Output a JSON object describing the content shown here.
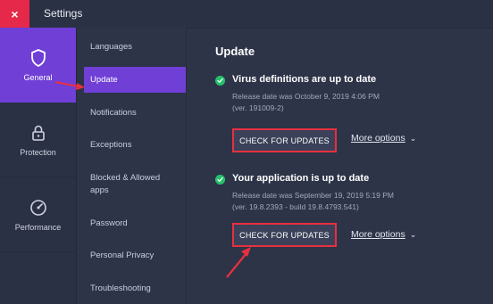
{
  "window": {
    "title": "Settings",
    "close_glyph": "×"
  },
  "rail": [
    {
      "label": "General",
      "icon": "shield-icon",
      "active": true
    },
    {
      "label": "Protection",
      "icon": "lock-icon",
      "active": false
    },
    {
      "label": "Performance",
      "icon": "gauge-icon",
      "active": false
    }
  ],
  "nav": [
    {
      "label": "Languages"
    },
    {
      "label": "Update",
      "active": true
    },
    {
      "label": "Notifications"
    },
    {
      "label": "Exceptions"
    },
    {
      "label": "Blocked & Allowed apps"
    },
    {
      "label": "Password"
    },
    {
      "label": "Personal Privacy"
    },
    {
      "label": "Troubleshooting"
    }
  ],
  "content": {
    "title": "Update",
    "definitions": {
      "title": "Virus definitions are up to date",
      "release": "Release date was October 9, 2019 4:06 PM",
      "version": "(ver. 191009-2)",
      "button": "CHECK FOR UPDATES",
      "more": "More options"
    },
    "application": {
      "title": "Your application is up to date",
      "release": "Release date was September 19, 2019 5:19 PM",
      "version": "(ver. 19.8.2393 - build 19.8.4793.541)",
      "button": "CHECK FOR UPDATES",
      "more": "More options"
    }
  },
  "colors": {
    "accent": "#6f3fd6",
    "close": "#e6284a",
    "highlight": "#e8303f",
    "ok": "#25c26a",
    "background": "#2e3448"
  }
}
